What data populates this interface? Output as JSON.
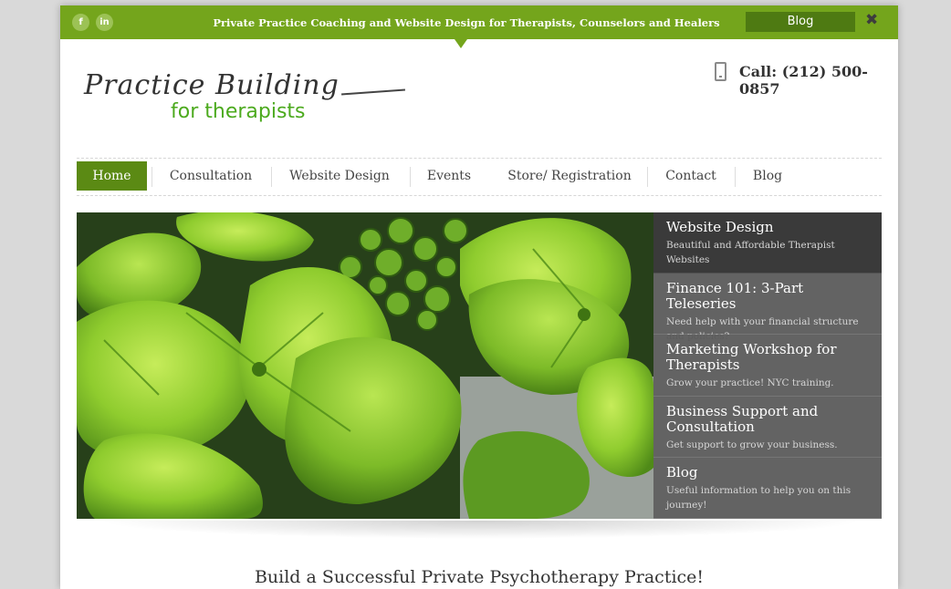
{
  "topbar": {
    "social": [
      "f",
      "in"
    ],
    "tagline": "Private Practice Coaching and Website Design for Therapists, Counselors and Healers",
    "blog_label": "Blog",
    "close_glyph": "✖"
  },
  "header": {
    "logo_main": "Practice Building",
    "logo_sub": "for therapists",
    "phone": "Call: (212) 500-0857"
  },
  "nav": {
    "items": [
      {
        "label": "Home"
      },
      {
        "label": "Consultation"
      },
      {
        "label": "Website Design"
      },
      {
        "label": "Events"
      },
      {
        "label": "Store/ Registration"
      },
      {
        "label": "Contact"
      },
      {
        "label": "Blog"
      }
    ]
  },
  "slider": {
    "items": [
      {
        "title": "Website Design",
        "desc": "Beautiful and Affordable Therapist Websites"
      },
      {
        "title": "Finance 101: 3-Part Teleseries",
        "desc": "Need help with your financial structure and policies?"
      },
      {
        "title": "Marketing Workshop for Therapists",
        "desc": "Grow your practice! NYC training."
      },
      {
        "title": "Business Support and Consultation",
        "desc": "Get support to grow your business."
      },
      {
        "title": "Blog",
        "desc": "Useful information to help you on this journey!"
      }
    ]
  },
  "main": {
    "heading": "Build a Successful Private Psychotherapy Practice!"
  },
  "colors": {
    "brand_green": "#74a51c",
    "nav_active": "#5b8a14",
    "slider_panel": "#3a3a3a"
  }
}
